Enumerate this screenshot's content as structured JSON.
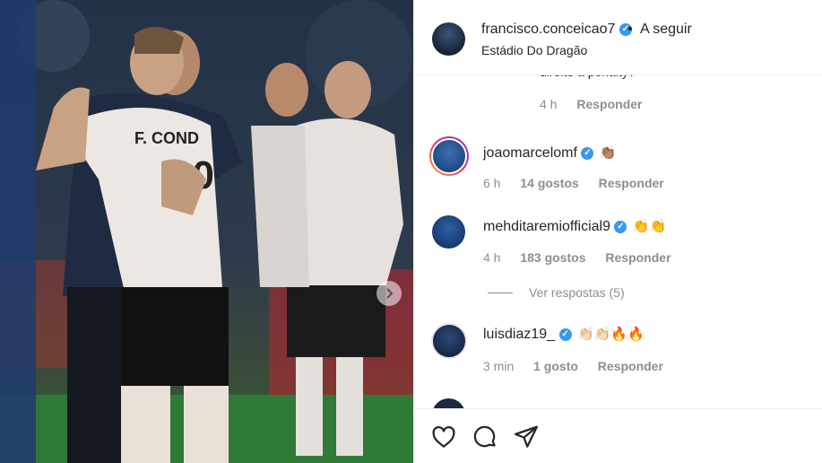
{
  "post": {
    "username": "francisco.conceicao7",
    "follow_label": "A seguir",
    "separator": "•",
    "location": "Estádio Do Dragão"
  },
  "comments": {
    "cut_text": "direito a penalty?",
    "first_meta": {
      "time": "4 h",
      "reply": "Responder"
    },
    "items": [
      {
        "user": "joaomarcelomf",
        "emojis": "👏🏽",
        "time": "6 h",
        "likes": "14 gostos",
        "reply": "Responder"
      },
      {
        "user": "mehditaremiofficial9",
        "emojis": "👏👏",
        "time": "4 h",
        "likes": "183 gostos",
        "reply": "Responder"
      },
      {
        "user": "luisdiaz19_",
        "emojis": "👏🏻👏🏻🔥🔥",
        "time": "3 min",
        "likes": "1 gosto",
        "reply": "Responder"
      }
    ],
    "view_replies": "Ver respostas (5)"
  },
  "icons": {
    "verified": "verified-badge-icon",
    "like": "heart-icon",
    "comment": "comment-bubble-icon",
    "share": "paper-plane-icon",
    "next": "chevron-right-icon"
  },
  "colors": {
    "verified": "#3897f0",
    "text": "#262626",
    "muted": "#8e8e8e"
  }
}
